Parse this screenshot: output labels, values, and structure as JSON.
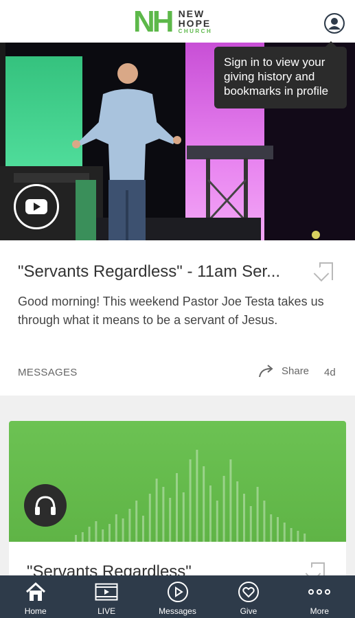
{
  "header": {
    "logo_mark": "NH",
    "logo_line1": "NEW",
    "logo_line2": "HOPE",
    "logo_line3": "CHURCH"
  },
  "tooltip": {
    "text": "Sign in to view your giving history and bookmarks in profile"
  },
  "card1": {
    "title": "\"Servants Regardless\" - 11am Ser...",
    "description": "Good morning! This weekend Pastor Joe Testa takes us through what it means to be a servant of Jesus.",
    "category": "MESSAGES",
    "share_label": "Share",
    "age": "4d"
  },
  "card2": {
    "title": "\"Servants Regardless\""
  },
  "tabbar": {
    "tabs": [
      {
        "label": "Home",
        "icon": "home-icon",
        "active": true
      },
      {
        "label": "LIVE",
        "icon": "live-video-icon",
        "active": false
      },
      {
        "label": "Messages",
        "icon": "play-circle-icon",
        "active": false
      },
      {
        "label": "Give",
        "icon": "heart-circle-icon",
        "active": false
      },
      {
        "label": "More",
        "icon": "more-dots-icon",
        "active": false
      }
    ]
  },
  "colors": {
    "brand_green": "#5db84a",
    "tabbar_bg": "#2e3b4a",
    "tooltip_bg": "#2b2b2b"
  }
}
